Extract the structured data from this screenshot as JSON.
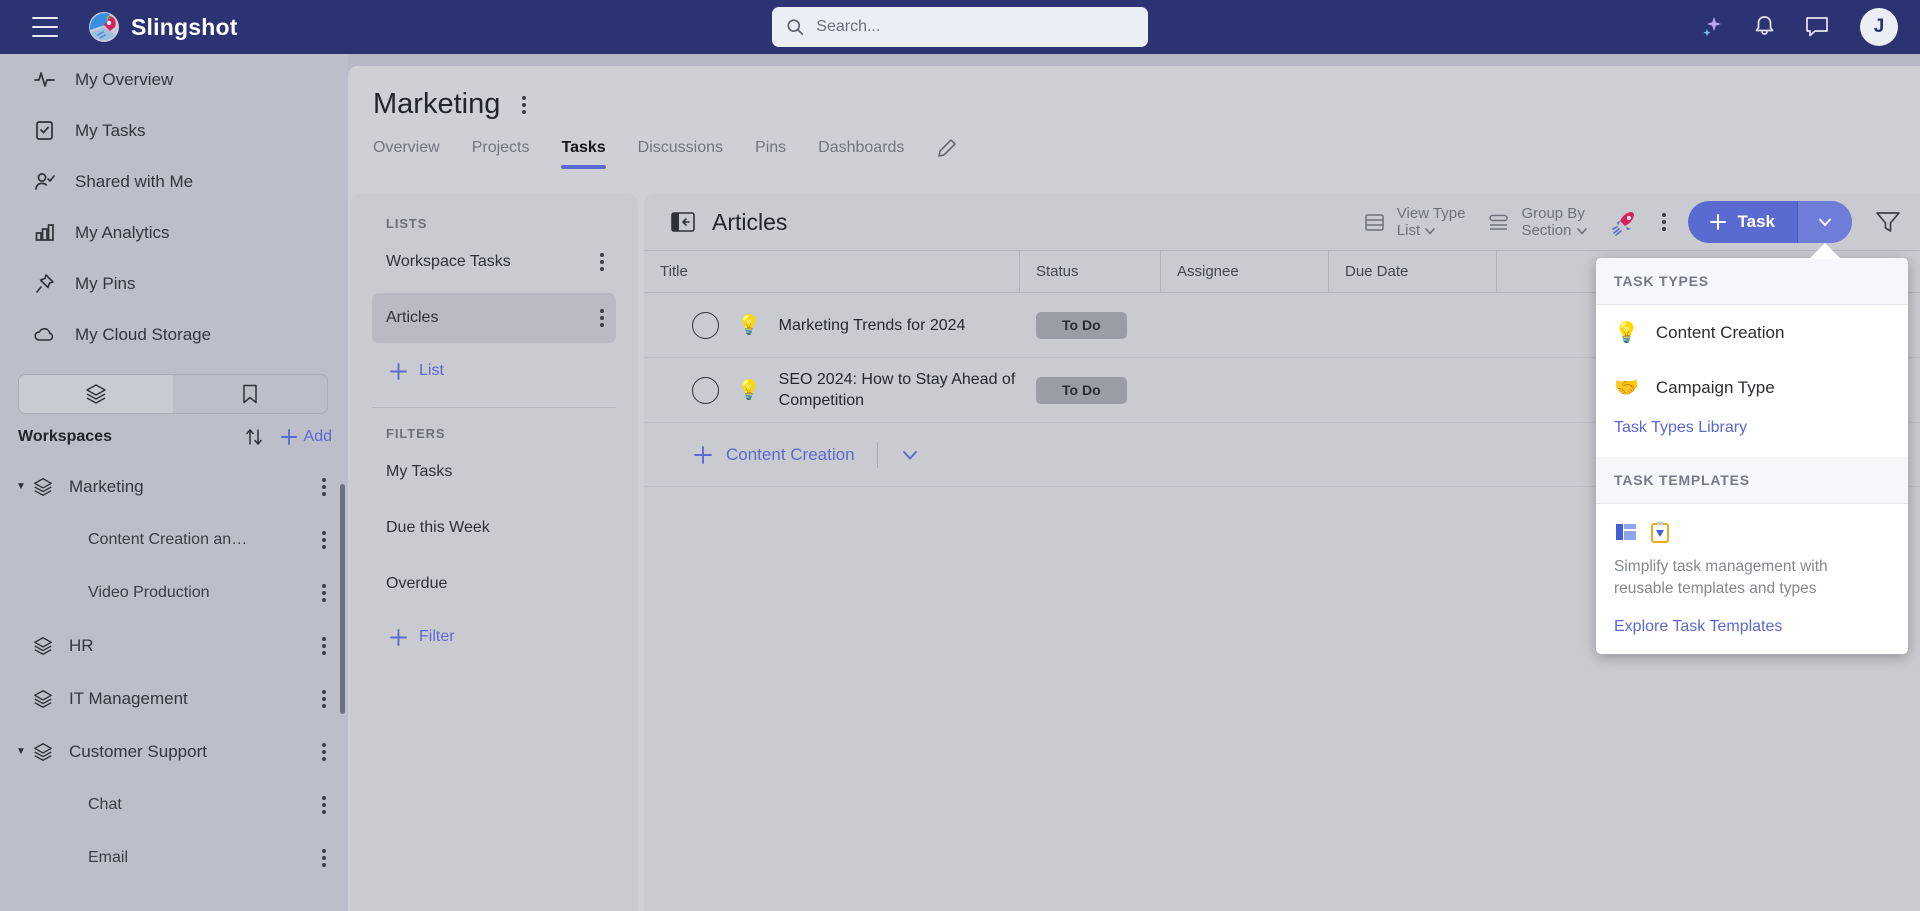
{
  "topbar": {
    "menu_icon": "hamburger-icon",
    "brand": "Slingshot",
    "search_placeholder": "Search...",
    "search_value": "",
    "icons": [
      "sparkle-ai-icon",
      "bell-notifications-icon",
      "chat-messages-icon"
    ],
    "avatar_initial": "J"
  },
  "sidebar": {
    "nav": [
      {
        "label": "My Overview",
        "icon": "activity-pulse-icon"
      },
      {
        "label": "My Tasks",
        "icon": "clipboard-check-icon"
      },
      {
        "label": "Shared with Me",
        "icon": "user-check-icon"
      },
      {
        "label": "My Analytics",
        "icon": "bar-chart-icon"
      },
      {
        "label": "My Pins",
        "icon": "pin-icon"
      },
      {
        "label": "My Cloud Storage",
        "icon": "cloud-icon"
      }
    ],
    "toggle": {
      "left_icon": "layers-icon",
      "right_icon": "bookmark-icon",
      "active": "left"
    },
    "workspaces_title": "Workspaces",
    "sort_icon": "sort-arrows-icon",
    "add_label": "Add",
    "workspaces": [
      {
        "label": "Marketing",
        "level": 0,
        "expanded": true
      },
      {
        "label": "Content Creation an…",
        "level": 1
      },
      {
        "label": "Video Production",
        "level": 1
      },
      {
        "label": "HR",
        "level": 0
      },
      {
        "label": "IT Management",
        "level": 0
      },
      {
        "label": "Customer Support",
        "level": 0,
        "expanded": true
      },
      {
        "label": "Chat",
        "level": 1
      },
      {
        "label": "Email",
        "level": 1
      }
    ]
  },
  "main": {
    "page_title": "Marketing",
    "tabs": [
      {
        "label": "Overview",
        "active": false
      },
      {
        "label": "Projects",
        "active": false
      },
      {
        "label": "Tasks",
        "active": true
      },
      {
        "label": "Discussions",
        "active": false
      },
      {
        "label": "Pins",
        "active": false
      },
      {
        "label": "Dashboards",
        "active": false
      }
    ],
    "edit_icon": "pencil-edit-icon"
  },
  "lists_panel": {
    "lists_caption": "LISTS",
    "lists": [
      {
        "label": "Workspace Tasks",
        "active": false
      },
      {
        "label": "Articles",
        "active": true
      }
    ],
    "add_list_label": "List",
    "filters_caption": "FILTERS",
    "filters": [
      {
        "label": "My Tasks"
      },
      {
        "label": "Due this Week"
      },
      {
        "label": "Overdue"
      }
    ],
    "add_filter_label": "Filter"
  },
  "tasks_panel": {
    "collapse_icon": "collapse-panel-icon",
    "title": "Articles",
    "view_type": {
      "label": "View Type",
      "value": "List",
      "icon": "list-view-icon"
    },
    "group_by": {
      "label": "Group By",
      "value": "Section",
      "icon": "group-by-icon"
    },
    "rocket_icon": "rocket-icon",
    "more_icon": "more-vertical-icon",
    "task_button": {
      "label": "Task",
      "plus_icon": "plus-icon",
      "caret_icon": "chevron-down-icon"
    },
    "filter_icon": "filter-funnel-icon",
    "columns": [
      "Title",
      "Status",
      "Assignee",
      "Due Date",
      ""
    ],
    "rows": [
      {
        "title": "Marketing Trends for 2024",
        "emoji": "💡",
        "status": "To Do",
        "assignee": "",
        "due_date": ""
      },
      {
        "title": "SEO 2024: How to Stay Ahead of Competition",
        "emoji": "💡",
        "status": "To Do",
        "assignee": "",
        "due_date": ""
      }
    ],
    "add_task": {
      "label": "Content Creation",
      "plus_icon": "plus-icon",
      "caret_icon": "chevron-down-icon"
    }
  },
  "dropdown": {
    "task_types_caption": "TASK TYPES",
    "task_types": [
      {
        "label": "Content Creation",
        "emoji": "💡"
      },
      {
        "label": "Campaign Type",
        "emoji": "🤝"
      }
    ],
    "task_types_library_link": "Task Types Library",
    "task_templates_caption": "TASK TEMPLATES",
    "template_description": "Simplify task management with reusable templates and types",
    "explore_link": "Explore Task Templates"
  },
  "colors": {
    "brand_navy": "#2c3372",
    "accent_blue": "#5b6ad0",
    "sidebar_bg": "#bcbec9",
    "panel_bg": "#cacbd1",
    "status_badge": "#9b9da6"
  }
}
